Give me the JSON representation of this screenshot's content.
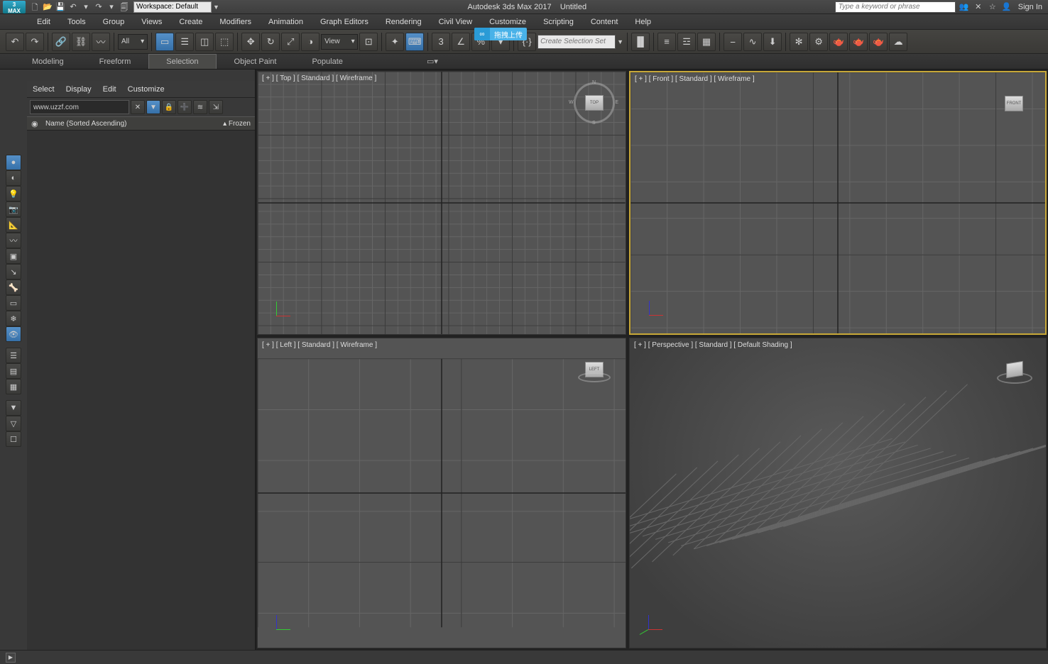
{
  "title": {
    "app": "Autodesk 3ds Max 2017",
    "doc": "Untitled",
    "workspace_label": "Workspace: Default",
    "search_placeholder": "Type a keyword or phrase",
    "signin": "Sign In"
  },
  "menus": [
    "Edit",
    "Tools",
    "Group",
    "Views",
    "Create",
    "Modifiers",
    "Animation",
    "Graph Editors",
    "Rendering",
    "Civil View",
    "Customize",
    "Scripting",
    "Content",
    "Help"
  ],
  "toolbar": {
    "filter": "All",
    "view": "View",
    "selset_placeholder": "Create Selection Set"
  },
  "overlay": {
    "text": "拖拽上传"
  },
  "ribbon": [
    "Modeling",
    "Freeform",
    "Selection",
    "Object Paint",
    "Populate"
  ],
  "se": {
    "tabs": [
      "Select",
      "Display",
      "Edit",
      "Customize"
    ],
    "search_value": "www.uzzf.com",
    "header_name": "Name (Sorted Ascending)",
    "header_frozen": "Frozen"
  },
  "viewports": {
    "tl": "[ + ] [ Top ] [ Standard ] [ Wireframe ]",
    "tr": "[ + ] [ Front ] [ Standard ] [ Wireframe ]",
    "bl": "[ + ] [ Left ] [ Standard ] [ Wireframe ]",
    "br": "[ + ] [ Perspective ] [ Standard ] [ Default Shading ]",
    "cube_top": "TOP",
    "cube_front": "FRONT",
    "cube_left": "LEFT"
  }
}
